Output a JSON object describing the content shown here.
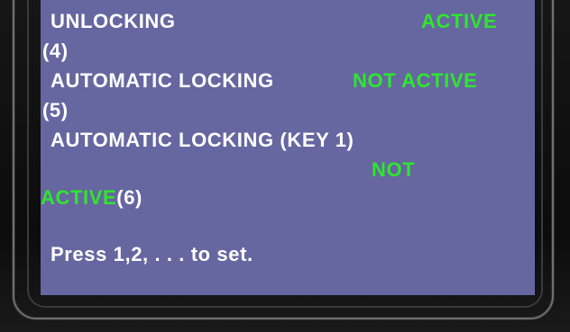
{
  "menu": {
    "row1_label": "UNLOCKING",
    "row1_status": "ACTIVE",
    "row1_num": "(4)",
    "row2_label": "AUTOMATIC LOCKING",
    "row2_status": "NOT ACTIVE",
    "row2_num": "(5)",
    "row3_label": "AUTOMATIC LOCKING (KEY 1)",
    "row3_status_a": "NOT",
    "row3_status_b": "ACTIVE",
    "row3_num": "(6)"
  },
  "footer": {
    "prompt": "Press 1,2, . . . to set."
  },
  "colors": {
    "screen_bg": "#6667a0",
    "active_green": "#2ee62e",
    "text_white": "#ffffff"
  }
}
